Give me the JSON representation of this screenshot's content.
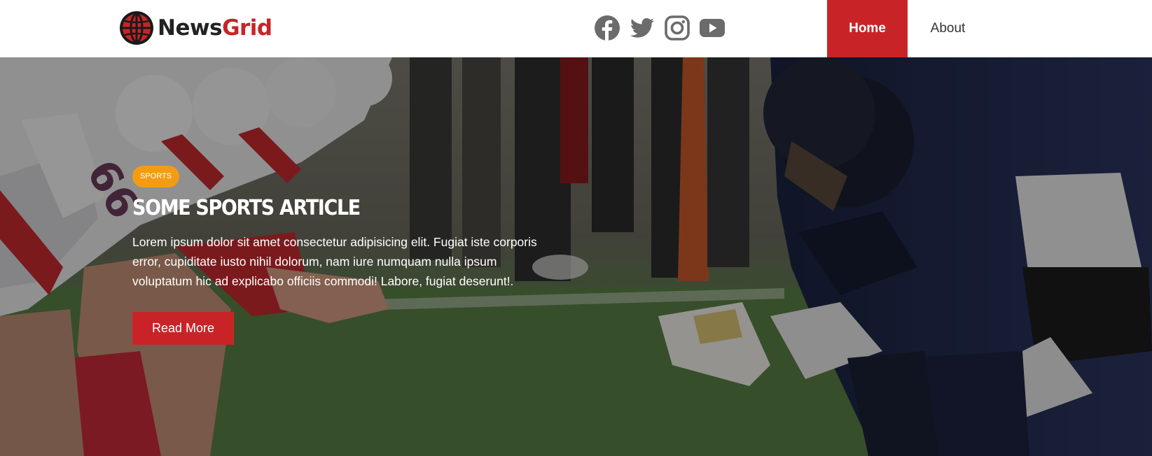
{
  "brand": {
    "part1": "News",
    "part2": "Grid"
  },
  "social": [
    {
      "name": "facebook-icon"
    },
    {
      "name": "twitter-icon"
    },
    {
      "name": "instagram-icon"
    },
    {
      "name": "youtube-icon"
    }
  ],
  "nav": {
    "home_label": "Home",
    "about_label": "About",
    "active": "Home"
  },
  "hero": {
    "category": "SPORTS",
    "title": "SOME SPORTS ARTICLE",
    "excerpt": "Lorem ipsum dolor sit amet consectetur adipisicing elit. Fugiat iste corporis error, cupiditate iusto nihil dolorum, nam iure numquam nulla ipsum voluptatum hic ad explicabo officiis commodi! Labore, fugiat deserunt!.",
    "button_label": "Read More",
    "background": "football-linemen-photo"
  },
  "colors": {
    "brand_red": "#c82428",
    "badge_orange": "#f39c12",
    "icon_gray": "#6b6b6b"
  }
}
